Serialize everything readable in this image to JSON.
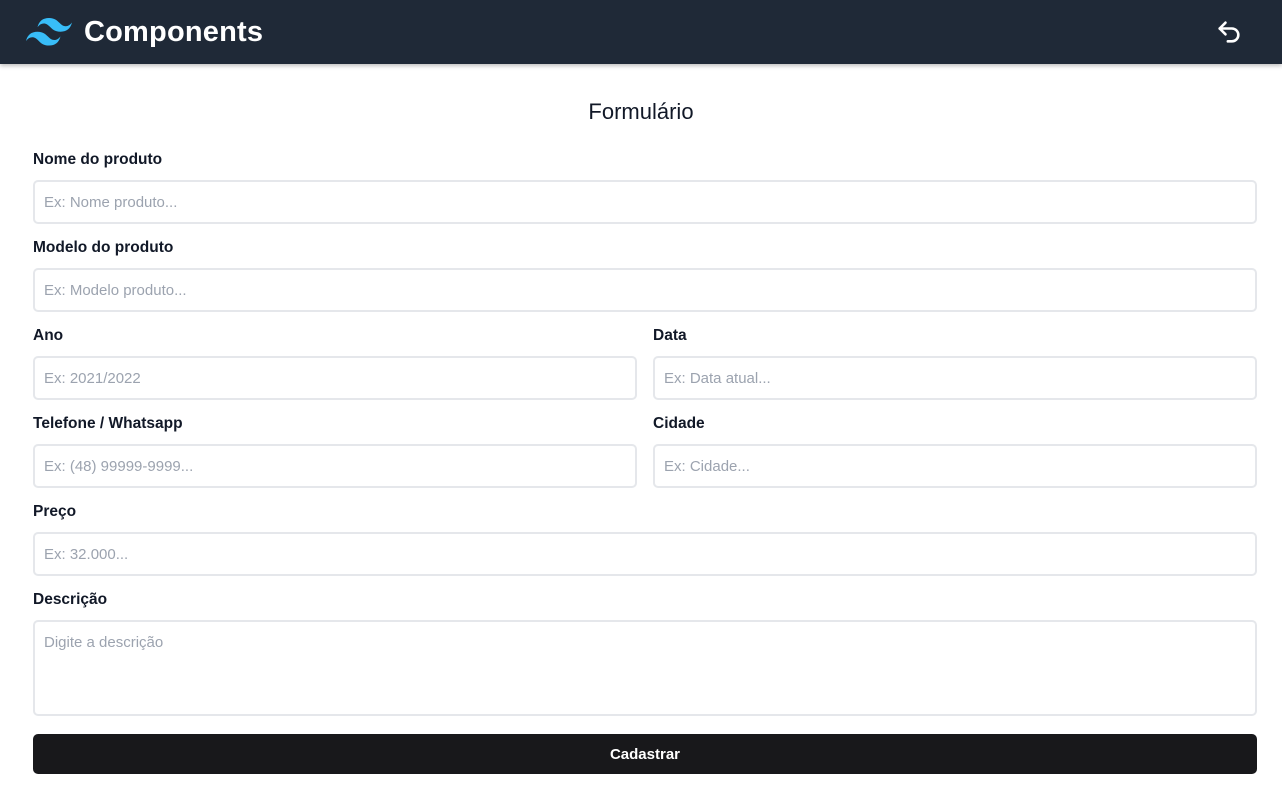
{
  "header": {
    "title": "Components",
    "logo_icon": "tailwind-wave-logo",
    "back_icon": "undo-arrow-icon"
  },
  "form": {
    "title": "Formulário",
    "fields": {
      "nome": {
        "label": "Nome do produto",
        "placeholder": "Ex: Nome produto..."
      },
      "modelo": {
        "label": "Modelo do produto",
        "placeholder": "Ex: Modelo produto..."
      },
      "ano": {
        "label": "Ano",
        "placeholder": "Ex: 2021/2022"
      },
      "data": {
        "label": "Data",
        "placeholder": "Ex: Data atual..."
      },
      "telefone": {
        "label": "Telefone / Whatsapp",
        "placeholder": "Ex: (48) 99999-9999..."
      },
      "cidade": {
        "label": "Cidade",
        "placeholder": "Ex: Cidade..."
      },
      "preco": {
        "label": "Preço",
        "placeholder": "Ex: 32.000..."
      },
      "descricao": {
        "label": "Descrição",
        "placeholder": "Digite a descrição"
      }
    },
    "submit_label": "Cadastrar"
  },
  "colors": {
    "header_bg": "#1f2937",
    "logo": "#38bdf8",
    "button_bg": "#18181b",
    "input_border": "#e5e7eb",
    "placeholder": "#9ca3af"
  }
}
